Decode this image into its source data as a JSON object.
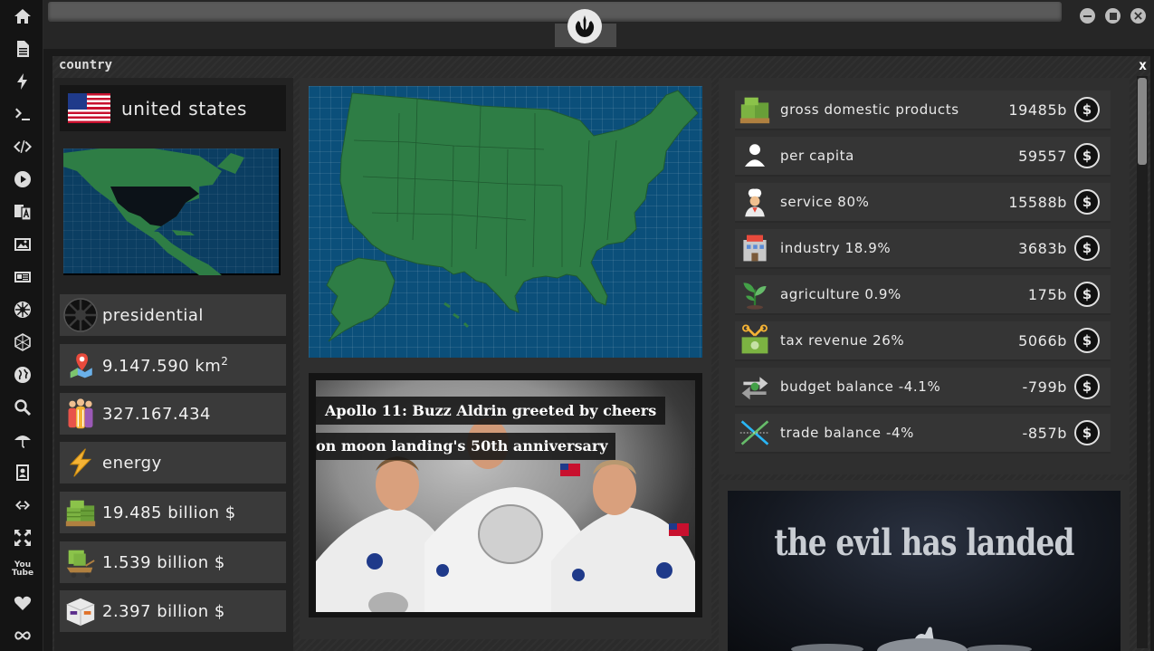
{
  "sidebar": {
    "icons": [
      "home-icon",
      "document-icon",
      "bolt-icon",
      "terminal-icon",
      "code-icon",
      "play-icon",
      "translate-icon",
      "image-icon",
      "news-icon",
      "imperial-icon",
      "sphere-icon",
      "globe-icon",
      "search-icon",
      "umbrella-icon",
      "contact-card-icon",
      "link-code-icon",
      "expand-icon",
      "youtube-icon",
      "heart-icon",
      "infinity-icon"
    ],
    "youtube_text": "You\nTube"
  },
  "window": {
    "close_symbol": "x"
  },
  "panel": {
    "title": "country",
    "close": "x"
  },
  "country": {
    "name": "united states",
    "government": "presidential",
    "area": "9.147.590 km",
    "area_sup": "2",
    "population": "327.167.434",
    "resource": "energy",
    "economy_1": "19.485 billion $",
    "economy_2": "1.539 billion $",
    "economy_3": "2.397 billion $"
  },
  "news": {
    "headline_1": "Apollo 11: Buzz Aldrin greeted by cheers",
    "headline_2": "on moon landing's 50th anniversary"
  },
  "stats": [
    {
      "label": "gross domestic products",
      "value": "19485b",
      "icon": "money-pallet-icon"
    },
    {
      "label": "per capita",
      "value": "59557",
      "icon": "person-icon"
    },
    {
      "label": "service 80%",
      "value": "15588b",
      "icon": "chef-icon"
    },
    {
      "label": "industry 18.9%",
      "value": "3683b",
      "icon": "factory-icon"
    },
    {
      "label": "agriculture 0.9%",
      "value": "175b",
      "icon": "plant-icon"
    },
    {
      "label": "tax revenue 26%",
      "value": "5066b",
      "icon": "tax-cash-icon"
    },
    {
      "label": "budget balance -4.1%",
      "value": "-799b",
      "icon": "balance-arrows-icon"
    },
    {
      "label": "trade balance -4%",
      "value": "-857b",
      "icon": "trade-cross-icon"
    }
  ],
  "coin_symbol": "$",
  "promo": {
    "title": "the evil has landed"
  },
  "colors": {
    "map_green": "#2e7d45",
    "map_ocean": "#0b4f7a",
    "panel_bg": "#2b2b2b"
  }
}
